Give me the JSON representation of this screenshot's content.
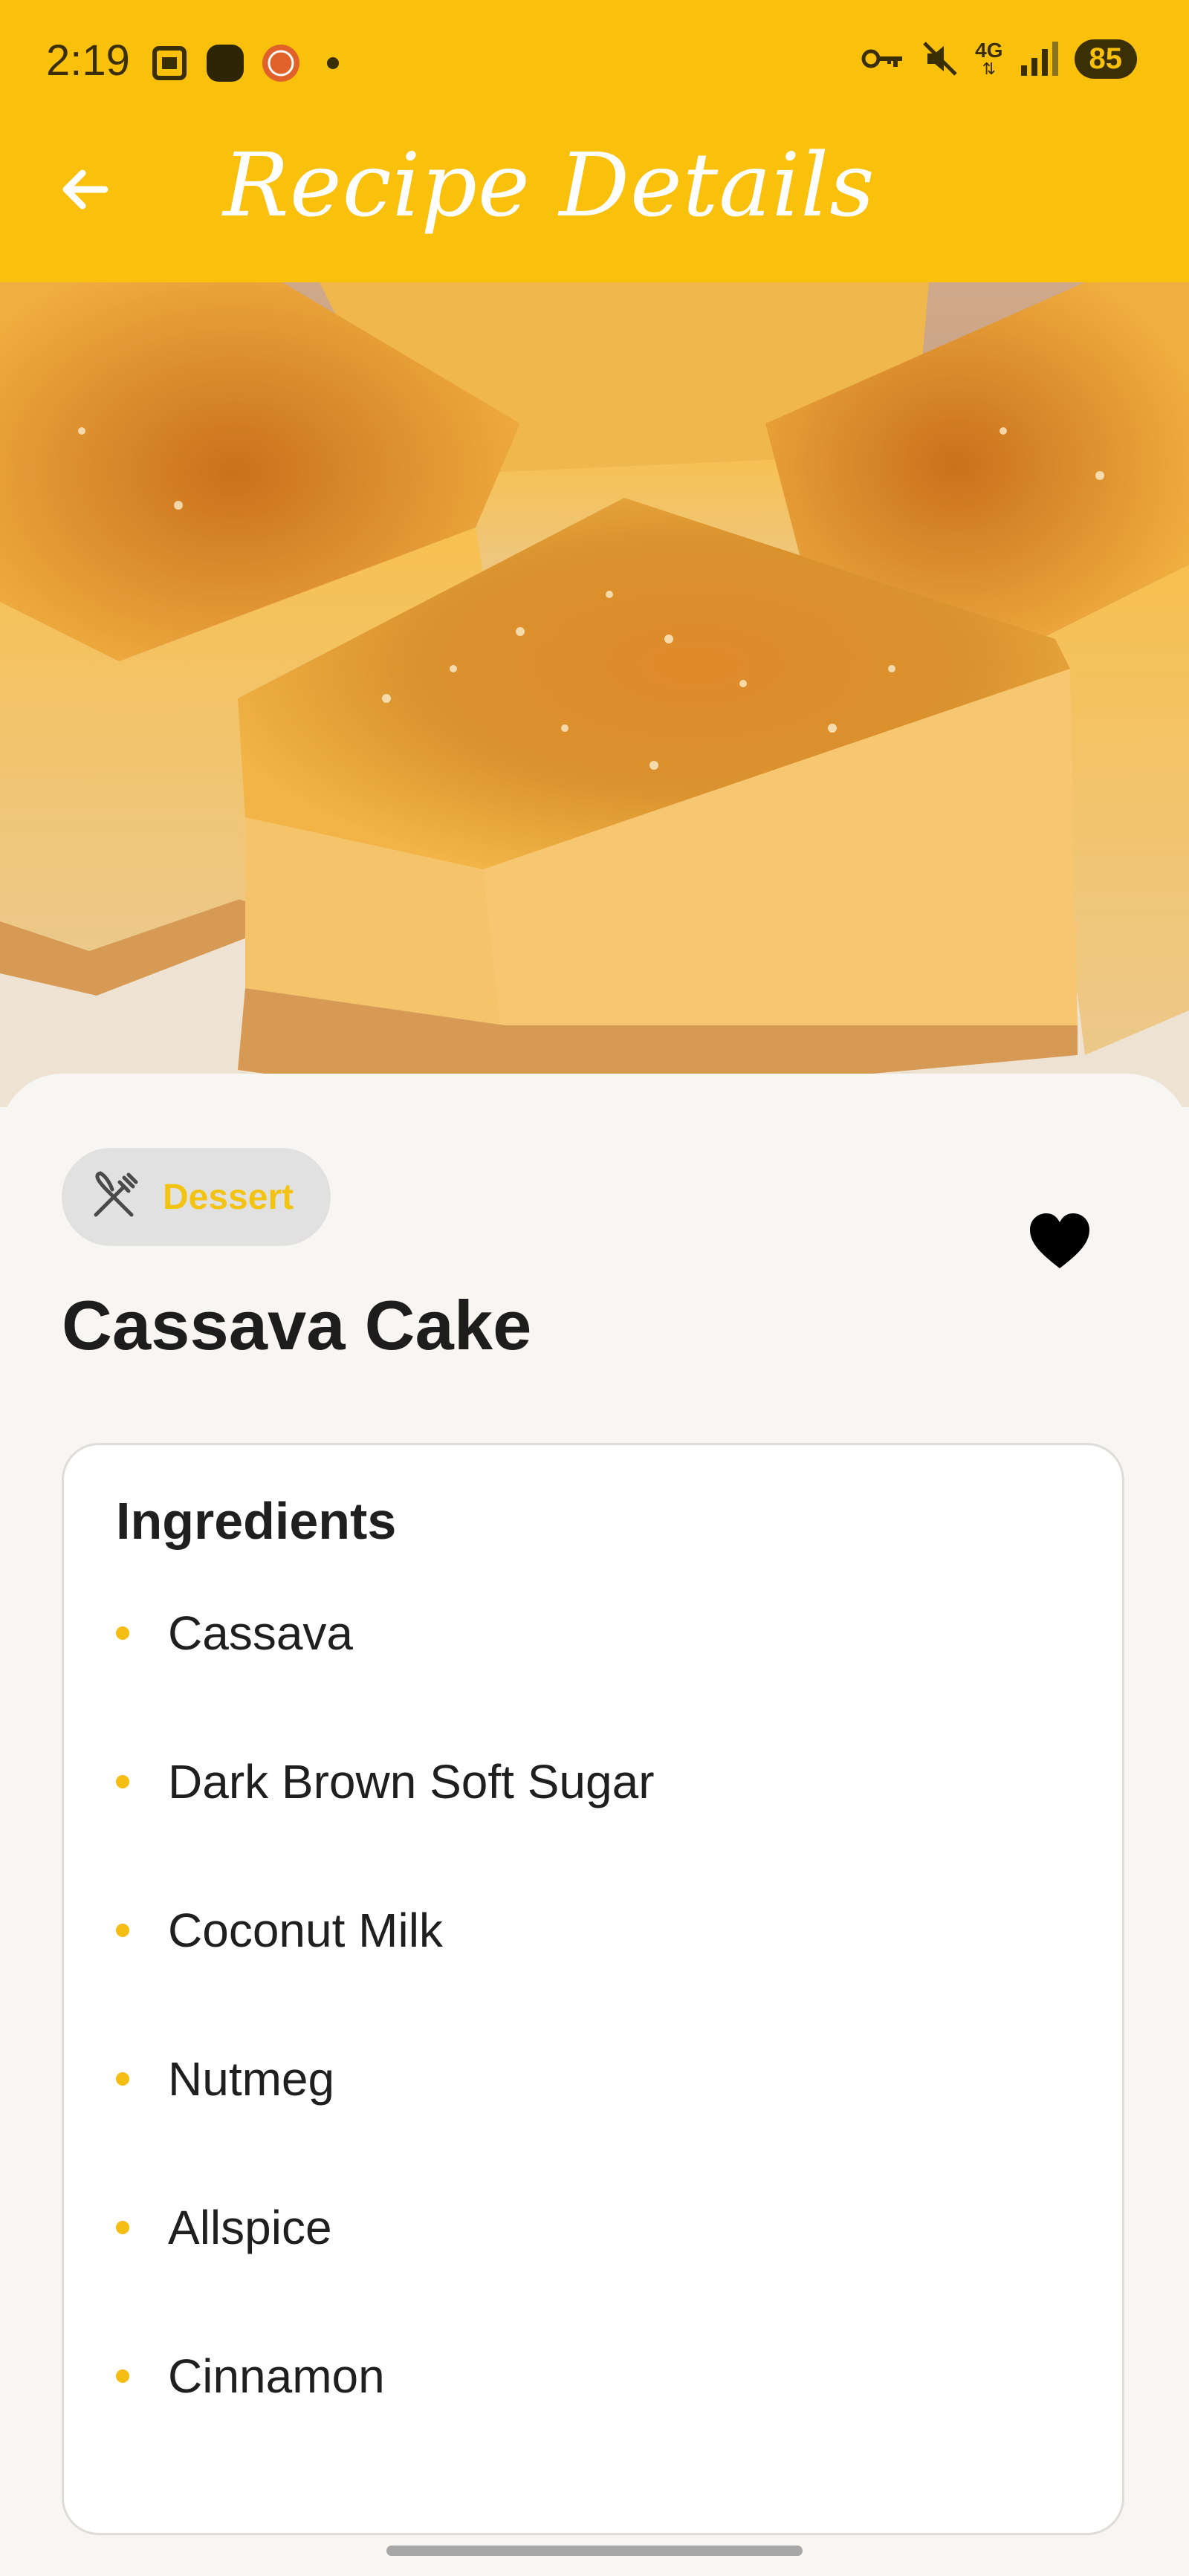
{
  "status_bar": {
    "time": "2:19",
    "network": "4G",
    "battery": "85"
  },
  "app_bar": {
    "title": "Recipe Details",
    "back_icon": "arrow-left-icon"
  },
  "hero_image": {
    "alt": "Cassava Cake"
  },
  "recipe": {
    "category": "Dessert",
    "category_icon": "utensils-crossed-icon",
    "name": "Cassava Cake",
    "favorite_icon": "heart-icon",
    "favorited": true
  },
  "ingredients": {
    "heading": "Ingredients",
    "items": [
      "Cassava",
      "Dark Brown Soft Sugar",
      "Coconut Milk",
      "Nutmeg",
      "Allspice",
      "Cinnamon"
    ]
  },
  "colors": {
    "accent": "#f9c00c",
    "chip_text": "#f3c313",
    "bullet": "#f6bd14",
    "background": "#f7f6f2"
  }
}
